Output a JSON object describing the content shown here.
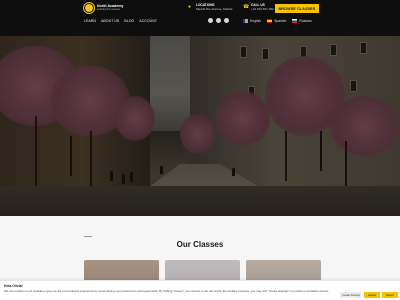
{
  "header": {
    "logo": {
      "name": "North Academy",
      "tagline": "Learning for everyone"
    },
    "location": {
      "title": "LOCATIONS",
      "value": "Madrid Río Avenue, Madrid"
    },
    "call": {
      "title": "CALL US",
      "value": "+34 919 651 282"
    },
    "book_button": "BROWSE CLASSES",
    "nav": [
      "LEARN",
      "ABOUT US",
      "BLOG",
      "ACCOUNT"
    ],
    "social_icons": [
      "facebook-icon",
      "instagram-icon",
      "twitter-icon"
    ],
    "languages": [
      {
        "label": "English",
        "flag": "uk-flag-icon"
      },
      {
        "label": "Spanish",
        "flag": "spain-flag-icon"
      },
      {
        "label": "Russian",
        "flag": "russia-flag-icon"
      }
    ]
  },
  "classes": {
    "title": "Our Classes",
    "cards": [
      "class-card-1",
      "class-card-2",
      "class-card-3"
    ]
  },
  "cookie": {
    "title": "Hola Olivia!",
    "text": "We use cookies on our website to give you the most relevant experience by remembering your preferences and repeat visits. By clicking \"Accept\", you consent to the use of ALL the cookies. However, you may visit \"Cookie Settings\" to provide a controlled consent.",
    "settings": "Cookie Settings",
    "accept": "Accept",
    "reject": "Reject"
  },
  "colors": {
    "accent": "#f5c400",
    "header_bg": "#0e0e0e"
  }
}
